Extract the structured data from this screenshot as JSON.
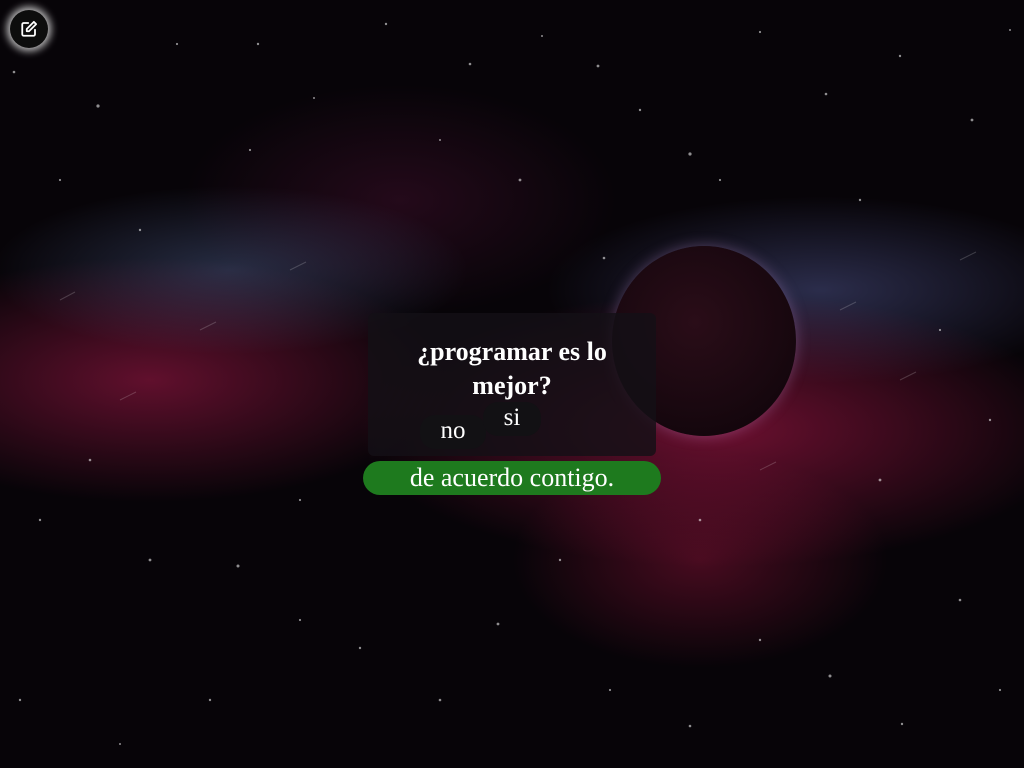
{
  "toolbar": {
    "edit_icon": "edit-icon"
  },
  "quiz": {
    "question": "¿programar es lo mejor?",
    "no_label": "no",
    "yes_label": "si",
    "answer_text": "de acuerdo contigo."
  },
  "colors": {
    "answer_background": "#1e7a1e",
    "card_background": "#141016",
    "button_background": "#121114"
  }
}
